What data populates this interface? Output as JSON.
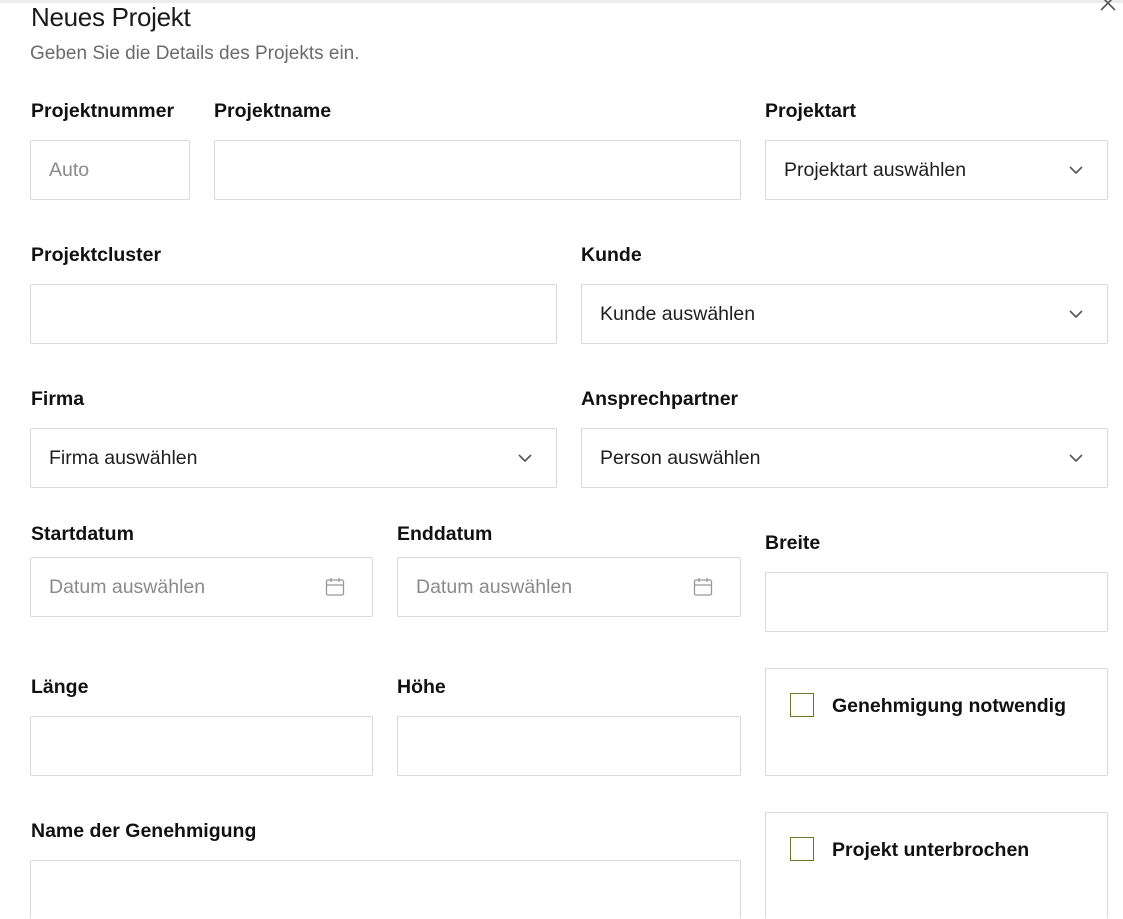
{
  "dialog": {
    "title": "Neues Projekt",
    "subtitle": "Geben Sie die Details des Projekts ein."
  },
  "icons": {
    "close": "close-icon",
    "dropdown": "chevron-down-icon",
    "calendar": "calendar-icon"
  },
  "colors": {
    "checkbox_border": "#6b7a2a",
    "field_border": "#d9d9d9",
    "placeholder": "#8a8a8a"
  },
  "form": {
    "projektnummer": {
      "label": "Projektnummer",
      "placeholder": "Auto",
      "value": ""
    },
    "projektname": {
      "label": "Projektname",
      "value": ""
    },
    "projektart": {
      "label": "Projektart",
      "selected": "Projektart auswählen"
    },
    "projektcluster": {
      "label": "Projektcluster",
      "value": ""
    },
    "kunde": {
      "label": "Kunde",
      "selected": "Kunde auswählen"
    },
    "firma": {
      "label": "Firma",
      "selected": "Firma auswählen"
    },
    "ansprechpartner": {
      "label": "Ansprechpartner",
      "selected": "Person auswählen"
    },
    "startdatum": {
      "label": "Startdatum",
      "placeholder": "Datum auswählen"
    },
    "enddatum": {
      "label": "Enddatum",
      "placeholder": "Datum auswählen"
    },
    "breite": {
      "label": "Breite",
      "value": ""
    },
    "laenge": {
      "label": "Länge",
      "value": ""
    },
    "hoehe": {
      "label": "Höhe",
      "value": ""
    },
    "genehmigung_notwendig": {
      "label": "Genehmigung notwendig",
      "checked": false
    },
    "name_der_genehmigung": {
      "label": "Name der Genehmigung",
      "value": ""
    },
    "projekt_unterbrochen": {
      "label": "Projekt unterbrochen",
      "checked": false
    }
  }
}
